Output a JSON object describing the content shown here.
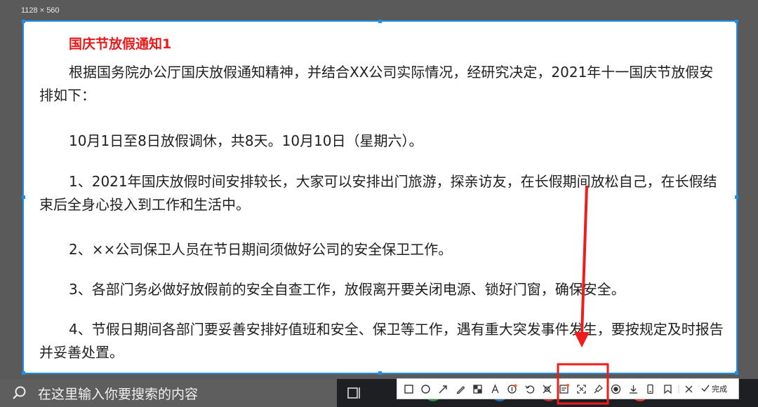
{
  "capture": {
    "size_label": "1128 × 560"
  },
  "document": {
    "title": "国庆节放假通知1",
    "paragraphs": [
      "根据国务院办公厅国庆放假通知精神，并结合XX公司实际情况，经研究决定，2021年十一国庆节放假安排如下：",
      "10月1日至8日放假调休，共8天。10月10日（星期六）。",
      "1、2021年国庆放假时间安排较长，大家可以安排出门旅游，探亲访友，在长假期间放松自己，在长假结束后全身心投入到工作和生活中。",
      "2、××公司保卫人员在节日期间须做好公司的安全保卫工作。",
      "3、各部门务必做好放假前的安全自查工作，放假离开要关闭电源、锁好门窗，确保安全。",
      "4、节假日期间各部门要妥善安排好值班和安全、保卫等工作，遇有重大突发事件发生，要按规定及时报告并妥善处置。"
    ]
  },
  "toolbar": {
    "done_label": "完成",
    "tools": [
      "rectangle-icon",
      "ellipse-icon",
      "arrow-icon",
      "pen-icon",
      "mosaic-icon",
      "text-icon",
      "number-icon",
      "undo-icon",
      "long-screenshot-icon",
      "ocr-icon",
      "scan-icon",
      "pin-icon",
      "record-icon",
      "download-icon",
      "phone-icon",
      "bookmark-icon",
      "close-icon"
    ]
  },
  "taskbar": {
    "search_placeholder": "在这里输入你要搜索的内容"
  },
  "colors": {
    "title_red": "#e8191b",
    "selection_blue": "#1e8ee6",
    "annotation_red": "#ee1c1c"
  }
}
